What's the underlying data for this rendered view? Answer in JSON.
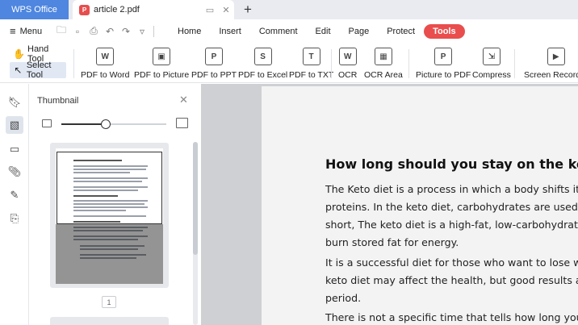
{
  "titlebar": {
    "app_tab": "WPS Office",
    "doc_tab": "article 2.pdf",
    "pdf_badge": "P"
  },
  "menu": {
    "menu_label": "Menu",
    "tabs": [
      {
        "label": "Home"
      },
      {
        "label": "Insert"
      },
      {
        "label": "Comment"
      },
      {
        "label": "Edit"
      },
      {
        "label": "Page"
      },
      {
        "label": "Protect"
      },
      {
        "label": "Tools",
        "active": true
      }
    ]
  },
  "ribbon": {
    "hand_tool": "Hand Tool",
    "select_tool": "Select Tool",
    "buttons": [
      {
        "label": "PDF to Word",
        "icon": "W"
      },
      {
        "label": "PDF to Picture",
        "icon": "▣"
      },
      {
        "label": "PDF to PPT",
        "icon": "P"
      },
      {
        "label": "PDF to Excel",
        "icon": "S"
      },
      {
        "label": "PDF to TXT",
        "icon": "T"
      },
      {
        "label": "OCR",
        "icon": "W"
      },
      {
        "label": "OCR Area",
        "icon": "▦"
      },
      {
        "label": "Picture to PDF",
        "icon": "P"
      },
      {
        "label": "Compress",
        "icon": "⇲"
      },
      {
        "label": "Screen Recorder",
        "icon": "▶"
      }
    ]
  },
  "thumbnail_panel": {
    "title": "Thumbnail",
    "zoom_level": 0.42,
    "page_number": "1"
  },
  "document": {
    "heading": "How long should you stay on the keto d",
    "paragraphs": [
      [
        "The Keto diet is a process in which a body shifts its",
        "proteins. In the keto diet, carbohydrates are used in",
        "short, The keto diet is a high-fat, low-carbohydrate",
        "burn stored fat for energy."
      ],
      [
        "It is a successful diet for those who want to lose we",
        "keto diet may affect the health, but good results are",
        "period."
      ],
      [
        "There is not a specific time that tells how long you s"
      ]
    ]
  },
  "colors": {
    "app_tab": "#4e86e0",
    "active_tab": "#ea4d4d",
    "pdf_badge": "#e84d4d",
    "doc_background": "#cfd0d3"
  }
}
